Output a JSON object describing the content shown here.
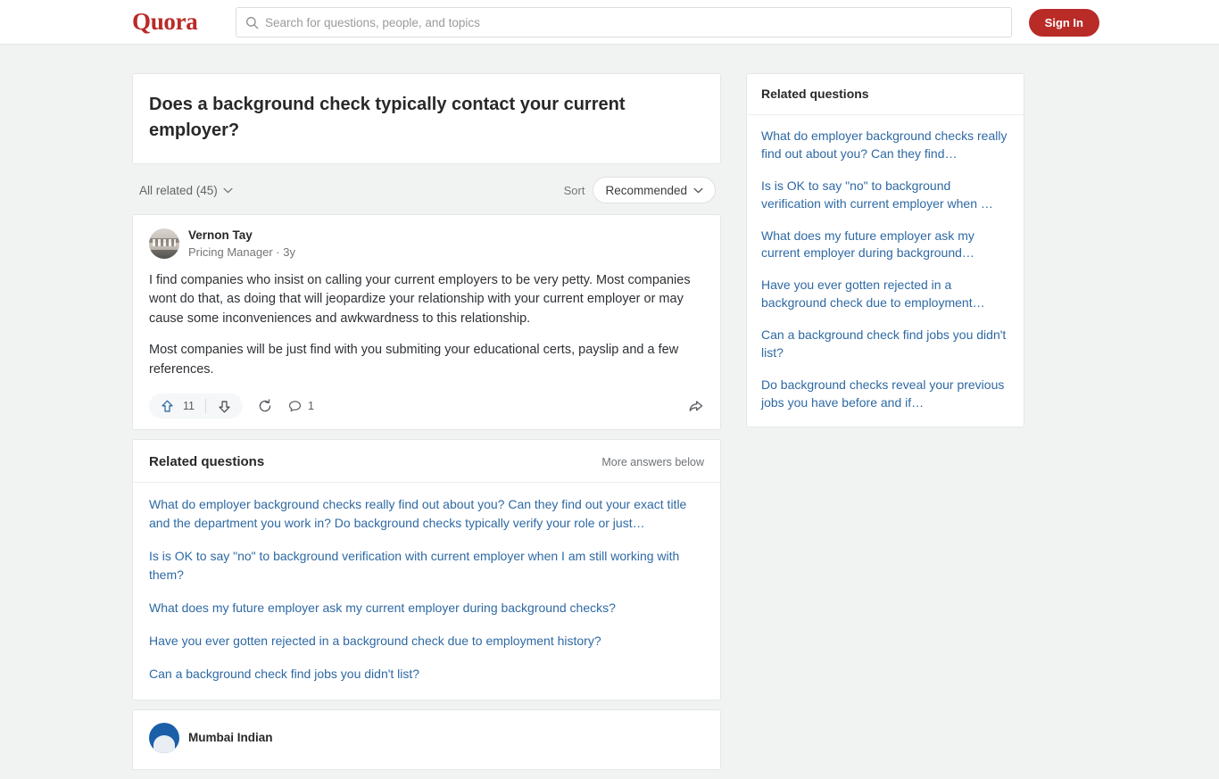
{
  "header": {
    "logo_text": "Quora",
    "search": {
      "placeholder": "Search for questions, people, and topics",
      "value": "",
      "icon": "search-icon"
    },
    "signin_label": "Sign In",
    "brand_color": "#b92b27"
  },
  "question": {
    "title": "Does a background check typically contact your current employer?"
  },
  "filters": {
    "all_related_label": "All related (45)",
    "sort_label": "Sort",
    "sort_value": "Recommended",
    "chevron_icon": "chevron-down-icon"
  },
  "answer": {
    "author_name": "Vernon Tay",
    "author_meta": "Pricing Manager · 3y",
    "avatar_alt": "colosseum-photo",
    "paragraphs": [
      "I find companies who insist on calling your current employers to be very petty. Most companies wont do that, as doing that will jeopardize your relationship with your current employer or may cause some inconveniences and awkwardness to this relationship.",
      "Most companies will be just find with you submiting your educational certs, payslip and a few references."
    ],
    "upvote_count": "11",
    "comment_count": "1",
    "upvote_color": "#2e69a3",
    "icons": {
      "upvote": "upvote-arrow-icon",
      "downvote": "downvote-arrow-icon",
      "repost": "repost-icon",
      "comment": "comment-bubble-icon",
      "share": "share-arrow-icon"
    }
  },
  "related_main": {
    "title": "Related questions",
    "more_label": "More answers below",
    "items": [
      "What do employer background checks really find out about you? Can they find out your exact title and the department you work in? Do background checks typically verify your role or just…",
      "Is is OK to say \"no\" to background verification with current employer when I am still working with them?",
      "What does my future employer ask my current employer during background checks?",
      "Have you ever gotten rejected in a background check due to employment history?",
      "Can a background check find jobs you didn't list?"
    ]
  },
  "next_answer": {
    "author_name": "Mumbai Indian",
    "avatar_alt": "blue-avatar"
  },
  "sidebar": {
    "title": "Related questions",
    "items": [
      "What do employer background checks really find out about you? Can they find…",
      "Is is OK to say \"no\" to background verification with current employer when …",
      "What does my future employer ask my current employer during background…",
      "Have you ever gotten rejected in a background check due to employment…",
      "Can a background check find jobs you didn't list?",
      "Do background checks reveal your previous jobs you have before and if…"
    ]
  }
}
